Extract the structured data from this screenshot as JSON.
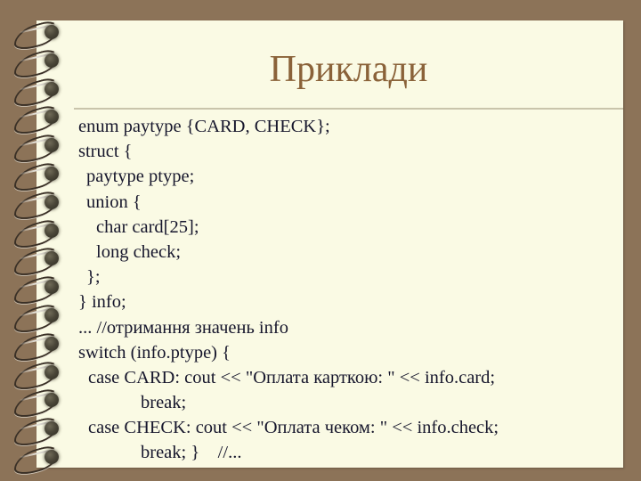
{
  "slide": {
    "title": "Приклади",
    "background_color": "#8c7358",
    "paper_color": "#fafae4",
    "title_color": "#8a6239",
    "rule_color": "#c9c4ab",
    "body_color": "#16162c",
    "binding": {
      "icon": "spiral-binding-icon",
      "ring_count": 16
    }
  },
  "body": {
    "lines": [
      {
        "indent": 0,
        "text": "enum paytype {CARD, CHECK};"
      },
      {
        "indent": 0,
        "text": "struct {"
      },
      {
        "indent": 1,
        "text": "paytype ptype;"
      },
      {
        "indent": 1,
        "text": "union {"
      },
      {
        "indent": 2,
        "text": "char card[25];"
      },
      {
        "indent": 2,
        "text": "long check;"
      },
      {
        "indent": 1,
        "text": "};"
      },
      {
        "indent": 0,
        "text": "} info;"
      },
      {
        "indent": 0,
        "text": "... //отримання значень info"
      },
      {
        "indent": 0,
        "text": "switch (info.ptype) {"
      },
      {
        "indent": 3,
        "text": "case CARD: cout << \"Оплата карткою: \" << info.card;"
      },
      {
        "indent": 4,
        "text": "break;"
      },
      {
        "indent": 3,
        "text": "case CHECK: cout << \"Оплата чеком: \" << info.check;"
      },
      {
        "indent": 4,
        "text": "break; }    //..."
      }
    ]
  }
}
